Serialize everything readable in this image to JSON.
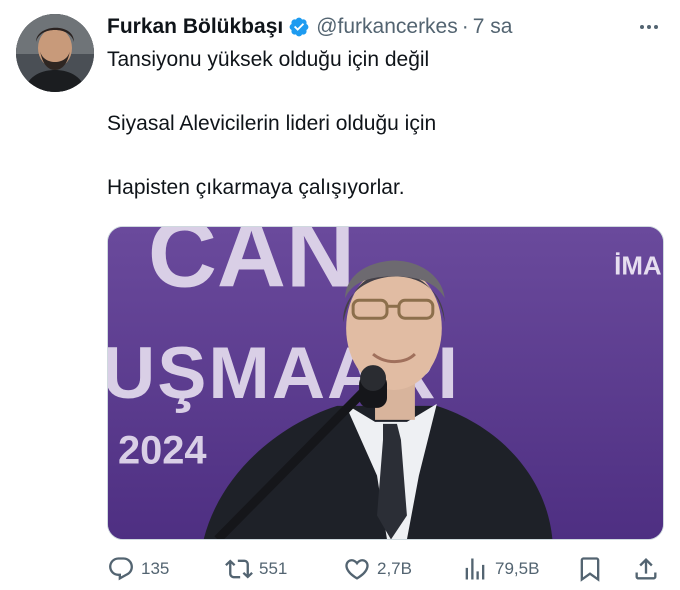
{
  "author": {
    "display_name": "Furkan Bölükbaşı",
    "handle": "@furkancerkes",
    "separator": "·",
    "time": "7 sa",
    "verified": true
  },
  "tweet": {
    "lines": [
      "Tansiyonu yüksek olduğu için değil",
      "Siyasal Alevicilerin lideri olduğu için",
      "Hapisten çıkarmaya çalışıyorlar."
    ]
  },
  "media": {
    "backdrop_text": {
      "line1": "CAN",
      "line2": "UŞMAARI",
      "year": "2024",
      "logo": "İMA"
    },
    "colors": {
      "backdrop": "#5b3a8e",
      "backdrop_text": "#d9cfe6"
    }
  },
  "actions": {
    "reply": {
      "icon": "reply-icon",
      "count": "135"
    },
    "retweet": {
      "icon": "retweet-icon",
      "count": "551"
    },
    "like": {
      "icon": "heart-icon",
      "count": "2,7B"
    },
    "views": {
      "icon": "views-icon",
      "count": "79,5B"
    },
    "bookmark": {
      "icon": "bookmark-icon"
    },
    "share": {
      "icon": "share-icon"
    }
  },
  "colors": {
    "text": "#0f1419",
    "secondary": "#536471",
    "verified": "#1d9bf0"
  }
}
